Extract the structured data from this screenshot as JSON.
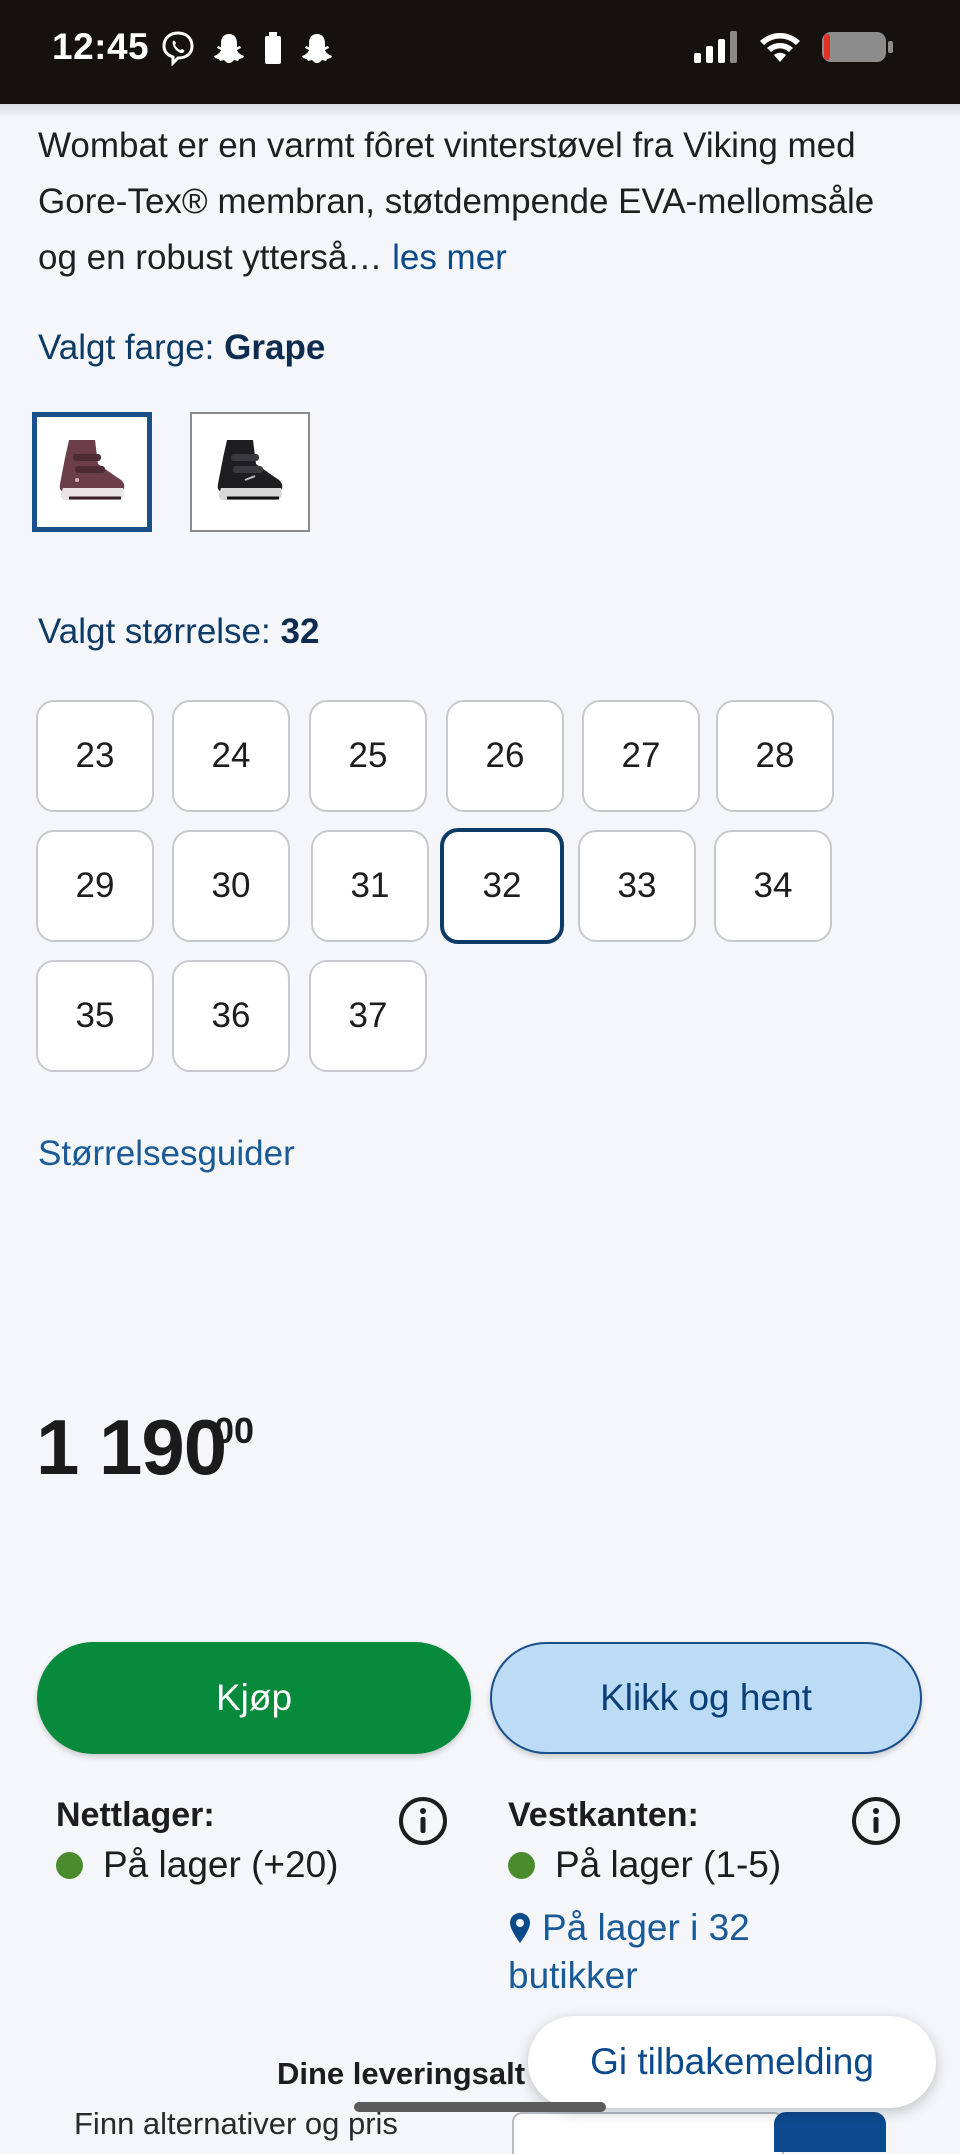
{
  "status_bar": {
    "time": "12:45"
  },
  "product": {
    "description": "Wombat er en varmt fôret vinterstøvel fra Viking med Gore-Tex® membran, støtdempende EVA-mellomsåle og en robust ytterså…",
    "read_more": "les mer"
  },
  "color": {
    "label": "Valgt farge:",
    "value": "Grape",
    "swatches": [
      "Grape",
      "Black"
    ]
  },
  "size": {
    "label": "Valgt størrelse:",
    "value": "32",
    "options": [
      "23",
      "24",
      "25",
      "26",
      "27",
      "28",
      "29",
      "30",
      "31",
      "32",
      "33",
      "34",
      "35",
      "36",
      "37"
    ],
    "guide_link": "Størrelsesguider"
  },
  "price": {
    "main": "1 190",
    "decimals": "00"
  },
  "actions": {
    "buy_label": "Kjøp",
    "click_collect_label": "Klikk og hent"
  },
  "stock": {
    "online_title": "Nettlager:",
    "online_status": "På lager (+20)",
    "store_title": "Vestkanten:",
    "store_status": "På lager (1-5)",
    "stores_link": "På lager i 32 butikker"
  },
  "delivery": {
    "heading": "Dine leveringsalt",
    "sub_text": "Finn alternativer og pris"
  },
  "feedback": {
    "label": "Gi tilbakemelding"
  },
  "colors": {
    "primary_navy": "#0d3b66",
    "buy_green": "#078a3c",
    "click_collect_bg": "#bcdcf6",
    "stock_dot": "#4a8b2d"
  }
}
